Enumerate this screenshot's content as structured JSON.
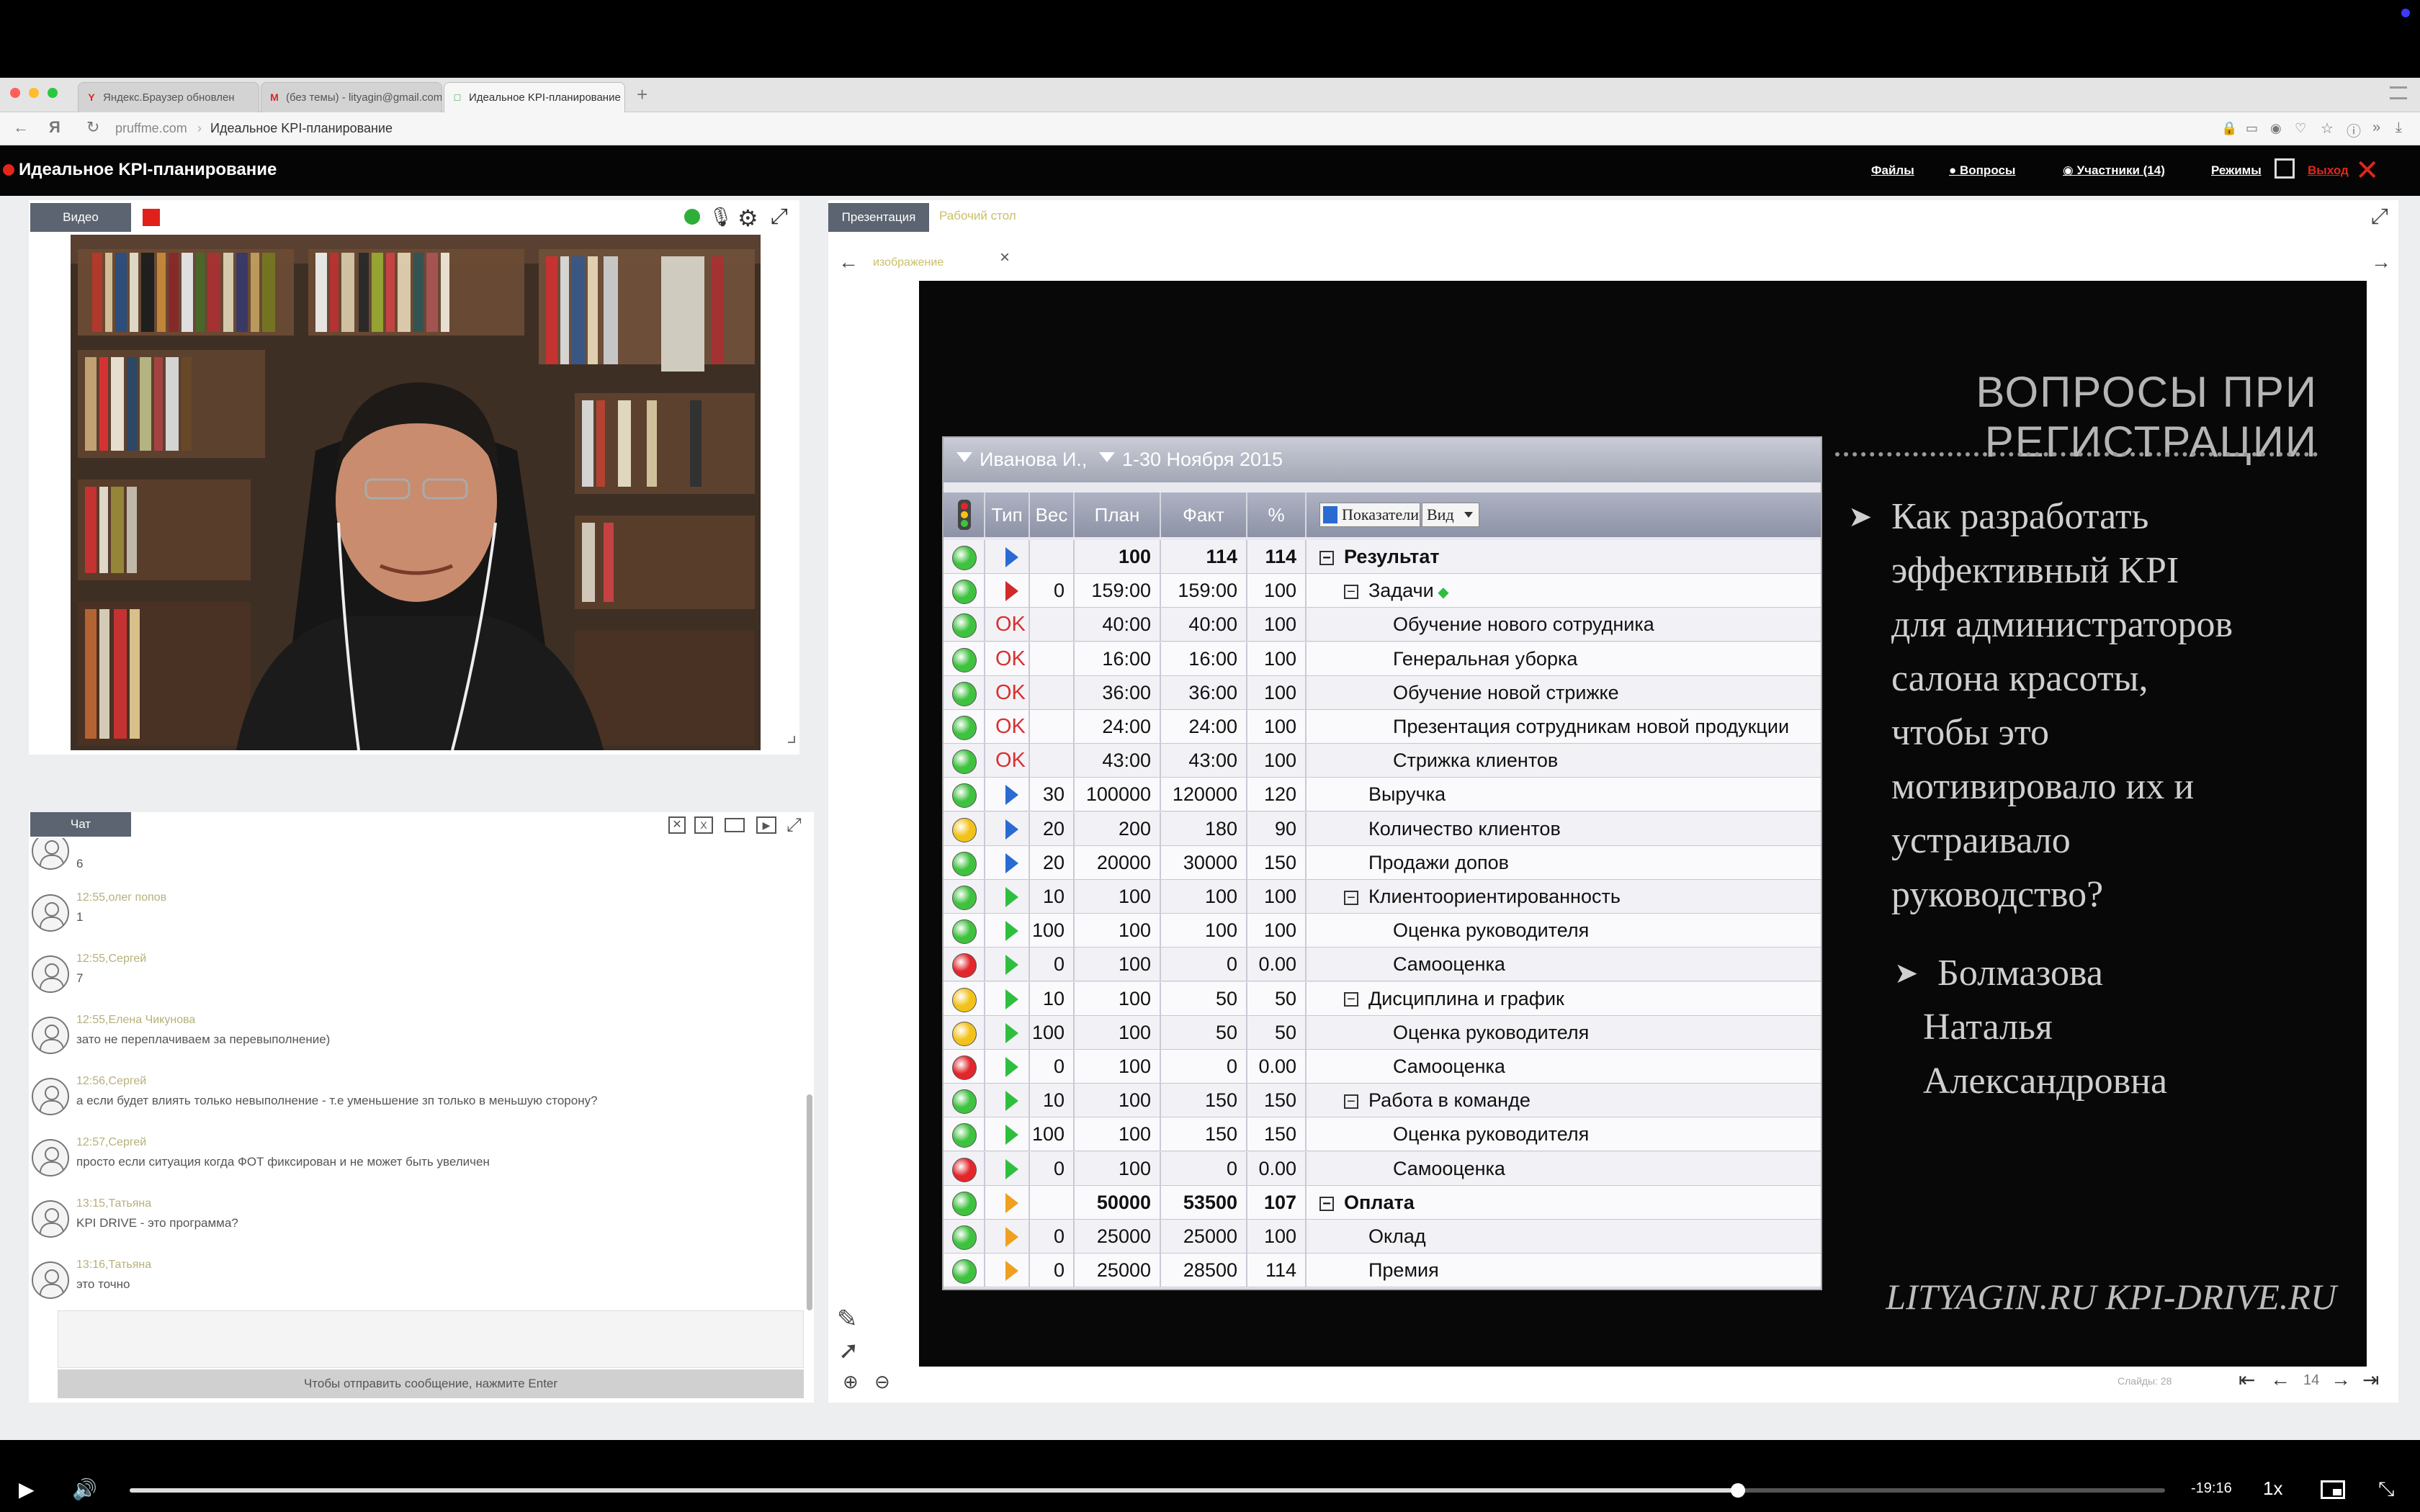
{
  "browser": {
    "tabs": [
      {
        "label": "Яндекс.Браузер обновлен",
        "icon": "Y"
      },
      {
        "label": "(без темы) - lityagin@gmail.com",
        "icon": "M"
      },
      {
        "label": "Идеальное KPI-планирование",
        "icon": "□"
      }
    ],
    "new_tab": "+",
    "domain": "pruffme.com",
    "page_title": "Идеальное KPI-планирование"
  },
  "app": {
    "title": "Идеальное KPI-планирование",
    "nav": {
      "files": "Файлы",
      "questions": "Вопросы",
      "participants": "Участники (14)",
      "modes": "Режимы",
      "exit": "Выход"
    }
  },
  "video_panel": {
    "tab": "Видео"
  },
  "chat": {
    "tab": "Чат",
    "input_hint": "Чтобы отправить сообщение, нажмите Enter",
    "messages": [
      {
        "meta": "",
        "text": "6"
      },
      {
        "meta": "12:55,олег попов",
        "text": "1"
      },
      {
        "meta": "12:55,Сергей",
        "text": "7"
      },
      {
        "meta": "12:55,Елена Чикунова",
        "text": "зато не переплачиваем за перевыполнение)"
      },
      {
        "meta": "12:56,Сергей",
        "text": "а если будет влиять только невыполнение - т.е уменьшение зп только в меньшую сторону?"
      },
      {
        "meta": "12:57,Сергей",
        "text": "просто если ситуация когда ФОТ фиксирован и не может быть увеличен"
      },
      {
        "meta": "13:15,Татьяна",
        "text": "KPI DRIVE - это программа?"
      },
      {
        "meta": "13:16,Татьяна",
        "text": "это точно"
      }
    ]
  },
  "presentation": {
    "tabs": {
      "presentation": "Презентация",
      "desktop": "Рабочий стол"
    },
    "file_label": "изображение",
    "close": "×",
    "slide_counter": "Слайды: 28",
    "page": "14"
  },
  "slide": {
    "title": "ВОПРОСЫ ПРИ РЕГИСТРАЦИИ",
    "bullets": [
      {
        "lines": [
          "Как разработать",
          "эффективный KPI",
          "для администраторов",
          "салона красоты,",
          "чтобы это",
          "мотивировало их и",
          "устраивало",
          "руководство?"
        ]
      },
      {
        "lines": [
          "Болмазова",
          "Наталья",
          "Александровна"
        ]
      }
    ],
    "bullet_marker": "➤",
    "footer": "LITYAGIN.RU  KPI-DRIVE.RU"
  },
  "kpi_table": {
    "employee": "Иванова И.,",
    "period": "1-30 Ноября 2015",
    "filter_indicators": "Показатели",
    "filter_view": "Вид",
    "columns": {
      "type": "Тип",
      "weight": "Вес",
      "plan": "План",
      "fact": "Факт",
      "pct": "%"
    },
    "colors": {
      "green": "#3fc23f",
      "yellow": "#f2c21a",
      "red": "#e2262b",
      "blue_tri": "#2a6bd1",
      "red_tri": "#d12a2a",
      "green_tri": "#2fbf3f",
      "orange_tri": "#f0a020"
    },
    "rows": [
      {
        "light": "green",
        "type": "blue",
        "weight": "",
        "plan": "100",
        "fact": "114",
        "pct": "114",
        "name": "Результат",
        "level": 0,
        "bold": true,
        "expander": "⊟"
      },
      {
        "light": "green",
        "type": "red",
        "weight": "0",
        "plan": "159:00",
        "fact": "159:00",
        "pct": "100",
        "name": "Задачи",
        "level": 1,
        "bold": false,
        "expander": "⊟",
        "diamond": true
      },
      {
        "light": "green",
        "type": "OK",
        "weight": "",
        "plan": "40:00",
        "fact": "40:00",
        "pct": "100",
        "name": "Обучение нового сотрудника",
        "level": 2
      },
      {
        "light": "green",
        "type": "OK",
        "weight": "",
        "plan": "16:00",
        "fact": "16:00",
        "pct": "100",
        "name": "Генеральная уборка",
        "level": 2
      },
      {
        "light": "green",
        "type": "OK",
        "weight": "",
        "plan": "36:00",
        "fact": "36:00",
        "pct": "100",
        "name": "Обучение новой стрижке",
        "level": 2
      },
      {
        "light": "green",
        "type": "OK",
        "weight": "",
        "plan": "24:00",
        "fact": "24:00",
        "pct": "100",
        "name": "Презентация сотрудникам новой продукции",
        "level": 2
      },
      {
        "light": "green",
        "type": "OK",
        "weight": "",
        "plan": "43:00",
        "fact": "43:00",
        "pct": "100",
        "name": "Стрижка клиентов",
        "level": 2
      },
      {
        "light": "green",
        "type": "blue",
        "weight": "30",
        "plan": "100000",
        "fact": "120000",
        "pct": "120",
        "name": "Выручка",
        "level": 1
      },
      {
        "light": "yellow",
        "type": "blue",
        "weight": "20",
        "plan": "200",
        "fact": "180",
        "pct": "90",
        "name": "Количество клиентов",
        "level": 1
      },
      {
        "light": "green",
        "type": "blue",
        "weight": "20",
        "plan": "20000",
        "fact": "30000",
        "pct": "150",
        "name": "Продажи допов",
        "level": 1
      },
      {
        "light": "green",
        "type": "green",
        "weight": "10",
        "plan": "100",
        "fact": "100",
        "pct": "100",
        "name": "Клиентоориентированность",
        "level": 1,
        "expander": "⊟"
      },
      {
        "light": "green",
        "type": "green",
        "weight": "100",
        "plan": "100",
        "fact": "100",
        "pct": "100",
        "name": "Оценка руководителя",
        "level": 2
      },
      {
        "light": "red",
        "type": "green",
        "weight": "0",
        "plan": "100",
        "fact": "0",
        "pct": "0.00",
        "name": "Самооценка",
        "level": 2
      },
      {
        "light": "yellow",
        "type": "green",
        "weight": "10",
        "plan": "100",
        "fact": "50",
        "pct": "50",
        "name": "Дисциплина и график",
        "level": 1,
        "expander": "⊟"
      },
      {
        "light": "yellow",
        "type": "green",
        "weight": "100",
        "plan": "100",
        "fact": "50",
        "pct": "50",
        "name": "Оценка руководителя",
        "level": 2
      },
      {
        "light": "red",
        "type": "green",
        "weight": "0",
        "plan": "100",
        "fact": "0",
        "pct": "0.00",
        "name": "Самооценка",
        "level": 2
      },
      {
        "light": "green",
        "type": "green",
        "weight": "10",
        "plan": "100",
        "fact": "150",
        "pct": "150",
        "name": "Работа в команде",
        "level": 1,
        "expander": "⊟"
      },
      {
        "light": "green",
        "type": "green",
        "weight": "100",
        "plan": "100",
        "fact": "150",
        "pct": "150",
        "name": "Оценка руководителя",
        "level": 2
      },
      {
        "light": "red",
        "type": "green",
        "weight": "0",
        "plan": "100",
        "fact": "0",
        "pct": "0.00",
        "name": "Самооценка",
        "level": 2
      },
      {
        "light": "green",
        "type": "orange",
        "weight": "",
        "plan": "50000",
        "fact": "53500",
        "pct": "107",
        "name": "Оплата",
        "level": 0,
        "bold": true,
        "expander": "⊟"
      },
      {
        "light": "green",
        "type": "orange",
        "weight": "0",
        "plan": "25000",
        "fact": "25000",
        "pct": "100",
        "name": "Оклад",
        "level": 1
      },
      {
        "light": "green",
        "type": "orange",
        "weight": "0",
        "plan": "25000",
        "fact": "28500",
        "pct": "114",
        "name": "Премия",
        "level": 1
      }
    ]
  },
  "player": {
    "time_remaining": "-19:16",
    "speed": "1x",
    "progress": 0.79
  }
}
